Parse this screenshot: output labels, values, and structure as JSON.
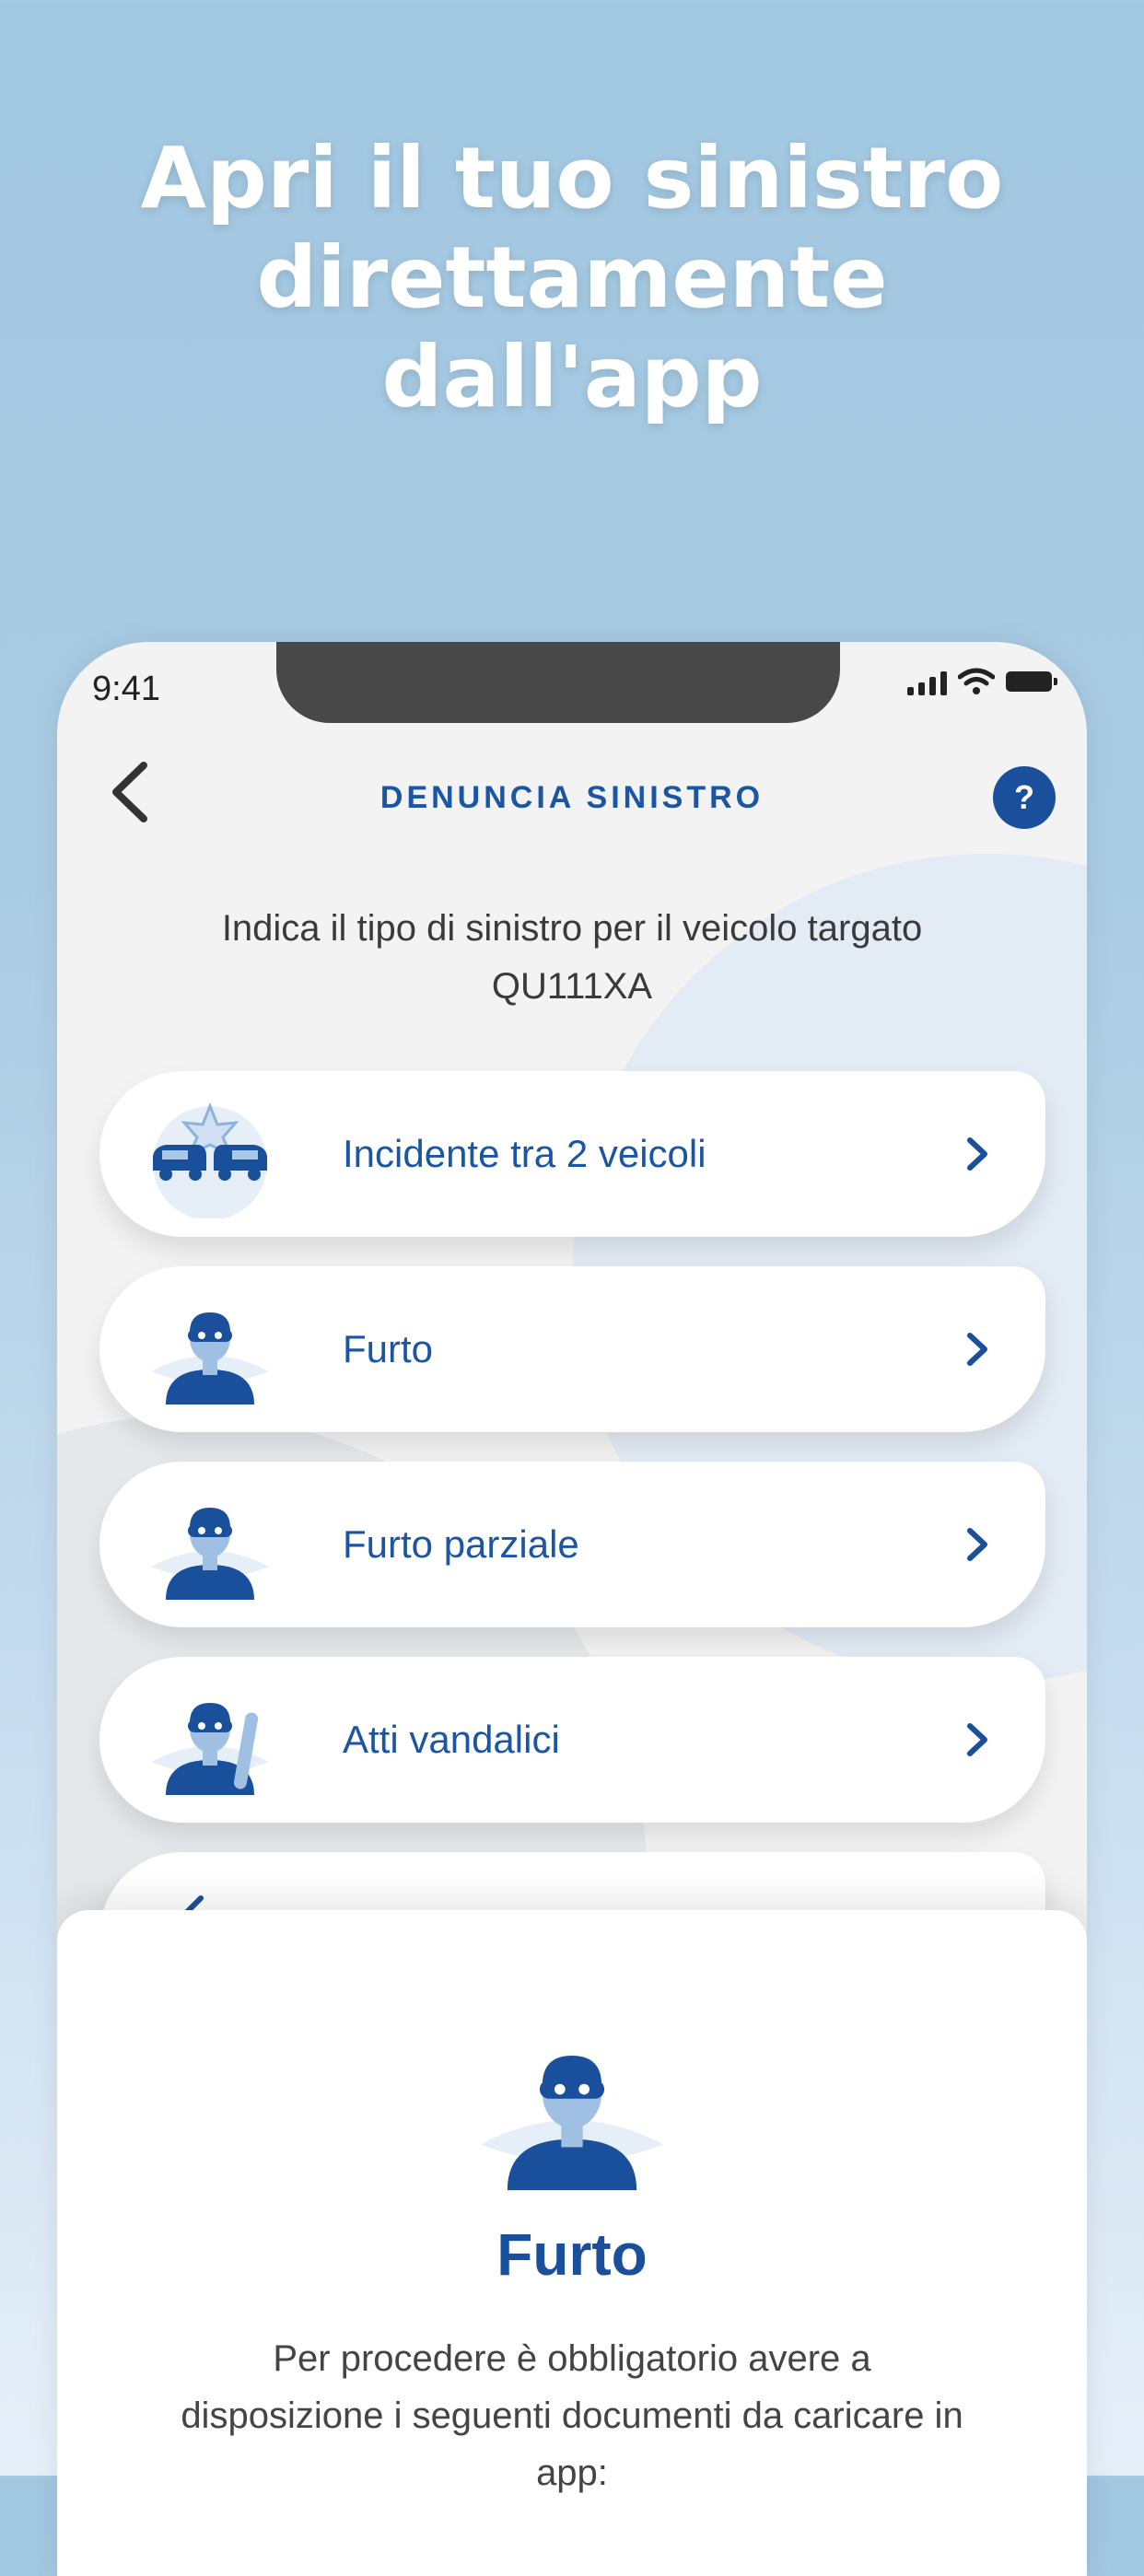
{
  "headline": {
    "line1": "Apri il tuo sinistro",
    "line2": "direttamente",
    "line3": "dall'app"
  },
  "status_bar": {
    "time": "9:41"
  },
  "nav": {
    "title": "DENUNCIA SINISTRO",
    "help_label": "?"
  },
  "instruction": {
    "line1": "Indica il tipo di sinistro per il veicolo targato",
    "line2": "QU111XA"
  },
  "options": [
    {
      "label": "Incidente tra 2 veicoli",
      "icon": "car-collision-icon"
    },
    {
      "label": "Furto",
      "icon": "thief-icon"
    },
    {
      "label": "Furto parziale",
      "icon": "thief-icon"
    },
    {
      "label": "Atti vandalici",
      "icon": "vandal-icon"
    }
  ],
  "sheet": {
    "title": "Furto",
    "text": "Per procedere è obbligatorio avere a disposizione i seguenti documenti da caricare in app:"
  },
  "colors": {
    "primary": "#1a4f9c",
    "accent_text": "#1a56a3",
    "background": "#a2c7e1"
  }
}
